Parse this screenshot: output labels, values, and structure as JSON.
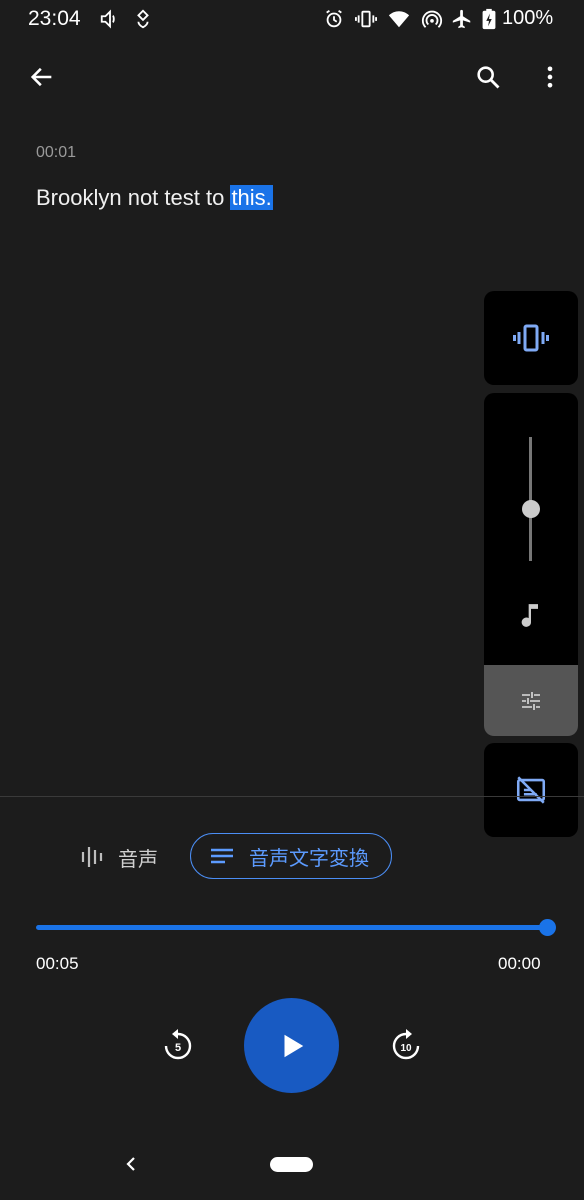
{
  "status_bar": {
    "time": "23:04",
    "battery": "100%",
    "icons": [
      "volume-icon",
      "location-heart-icon",
      "alarm-icon",
      "vibrate-icon",
      "wifi-icon",
      "hotspot-icon",
      "airplane-icon",
      "battery-charging-icon"
    ]
  },
  "app_bar": {
    "back_icon": "arrow-back-icon",
    "search_icon": "search-icon",
    "more_icon": "more-vert-icon"
  },
  "transcript": {
    "timestamp": "00:01",
    "text_plain": "Brooklyn not test to ",
    "text_highlighted": "this."
  },
  "volume_panel": {
    "ringer_icon": "vibrate-icon",
    "slider_level": 0.42,
    "media_icon": "music-note-icon",
    "settings_icon": "tune-icon",
    "captions_icon": "captions-off-icon"
  },
  "tabs": {
    "audio_label": "音声",
    "transcript_label": "音声文字変換"
  },
  "player": {
    "progress": 1.0,
    "elapsed": "00:05",
    "remaining": "00:00",
    "rewind_seconds": "5",
    "forward_seconds": "10"
  },
  "colors": {
    "background": "#1c1c1c",
    "accent": "#1a73e8",
    "play_button": "#185ac2"
  }
}
